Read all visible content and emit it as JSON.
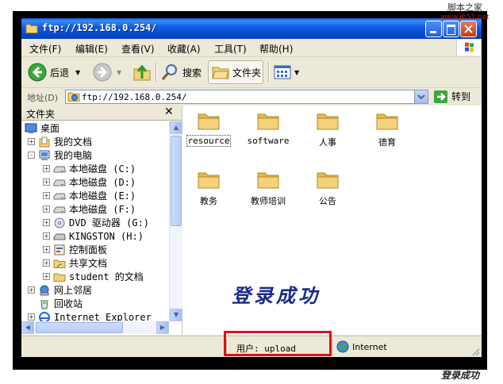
{
  "window": {
    "title": "ftp://192.168.0.254/"
  },
  "watermark": {
    "line1": "脚本之家",
    "line2": "www.Jb51.net"
  },
  "menu": [
    "文件(F)",
    "编辑(E)",
    "查看(V)",
    "收藏(A)",
    "工具(T)",
    "帮助(H)"
  ],
  "toolbar": {
    "back": "后退",
    "search": "搜索",
    "folders": "文件夹"
  },
  "address": {
    "label": "地址(D)",
    "value": "ftp://192.168.0.254/",
    "go": "转到"
  },
  "folders_pane": {
    "title": "文件夹",
    "items": [
      {
        "label": "桌面",
        "level": 0,
        "expander": ""
      },
      {
        "label": "我的文档",
        "level": 1,
        "expander": "+"
      },
      {
        "label": "我的电脑",
        "level": 1,
        "expander": "-"
      },
      {
        "label": "本地磁盘 (C:)",
        "level": 2,
        "expander": "+"
      },
      {
        "label": "本地磁盘 (D:)",
        "level": 2,
        "expander": "+"
      },
      {
        "label": "本地磁盘 (E:)",
        "level": 2,
        "expander": "+"
      },
      {
        "label": "本地磁盘 (F:)",
        "level": 2,
        "expander": "+"
      },
      {
        "label": "DVD 驱动器 (G:)",
        "level": 2,
        "expander": "+"
      },
      {
        "label": "KINGSTON (H:)",
        "level": 2,
        "expander": "+"
      },
      {
        "label": "控制面板",
        "level": 2,
        "expander": "+"
      },
      {
        "label": "共享文档",
        "level": 2,
        "expander": "+"
      },
      {
        "label": "student 的文档",
        "level": 2,
        "expander": "+"
      },
      {
        "label": "网上邻居",
        "level": 1,
        "expander": "+"
      },
      {
        "label": "回收站",
        "level": 1,
        "expander": ""
      },
      {
        "label": "Internet Explorer",
        "level": 1,
        "expander": "+"
      }
    ]
  },
  "files": [
    "resource",
    "software",
    "人事",
    "德育",
    "教务",
    "教师培训",
    "公告"
  ],
  "overlay_text": "登录成功",
  "status": {
    "user": "用户: upload",
    "zone": "Internet"
  },
  "caption": "登录成功",
  "colors": {
    "title_bar": "#0a5ee8",
    "highlight_box": "#e01010",
    "overlay_text": "#1a2a8c",
    "folder": "#f3d27a"
  }
}
